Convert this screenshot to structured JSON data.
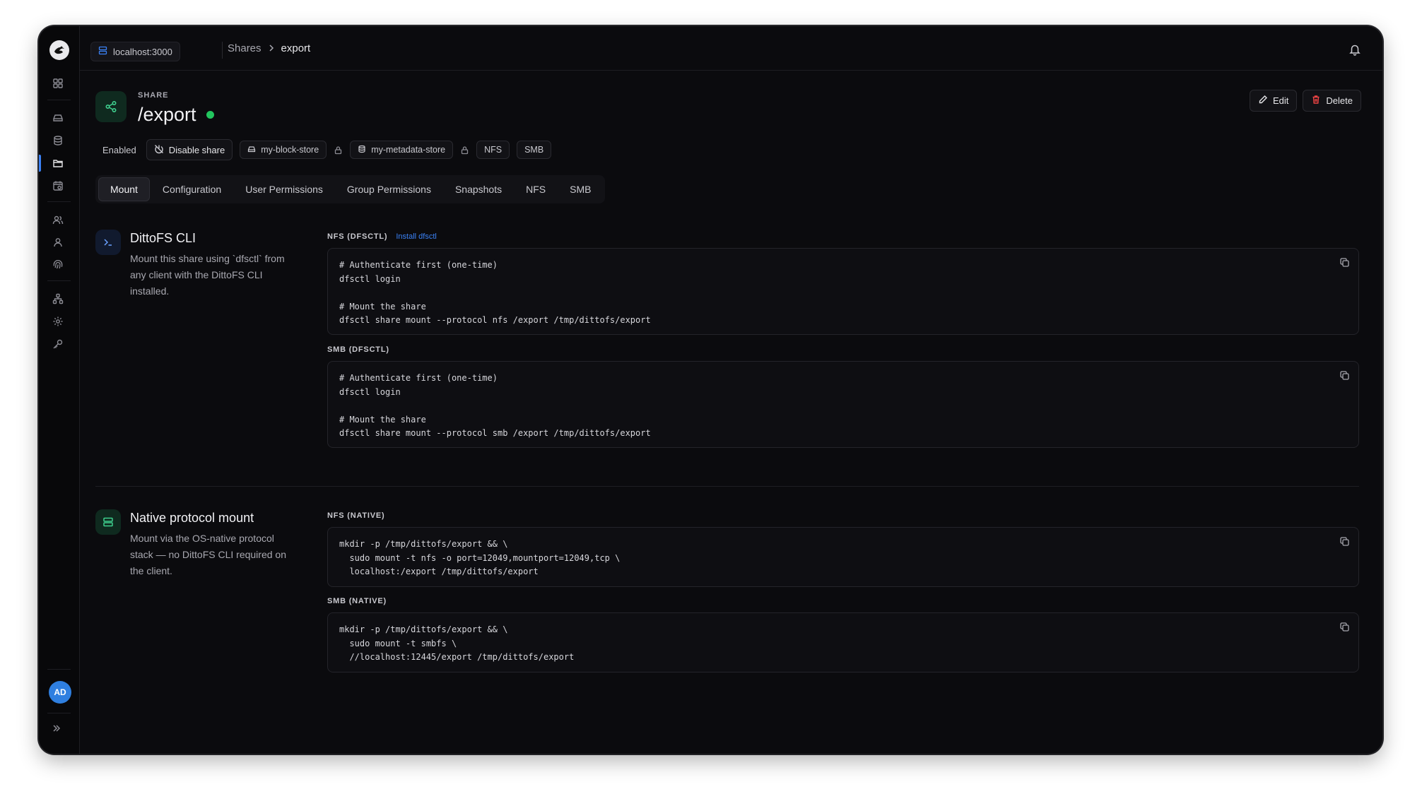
{
  "topbar": {
    "server": "localhost:3000",
    "breadcrumb": [
      "Shares",
      "export"
    ]
  },
  "share": {
    "kicker": "SHARE",
    "title": "/export",
    "status": "Enabled",
    "disable_label": "Disable share",
    "block_store": "my-block-store",
    "metadata_store": "my-metadata-store",
    "protocols": [
      "NFS",
      "SMB"
    ]
  },
  "actions": {
    "edit": "Edit",
    "delete": "Delete"
  },
  "tabs": [
    "Mount",
    "Configuration",
    "User Permissions",
    "Group Permissions",
    "Snapshots",
    "NFS",
    "SMB"
  ],
  "sections": {
    "cli": {
      "title": "DittoFS CLI",
      "description": "Mount this share using `dfsctl` from any client with the DittoFS CLI installed.",
      "nfs_label": "NFS (DFSCTL)",
      "install_link": "Install dfsctl",
      "nfs_code": [
        "# Authenticate first (one-time)",
        "dfsctl login",
        "",
        "# Mount the share",
        "dfsctl share mount --protocol nfs /export /tmp/dittofs/export"
      ],
      "smb_label": "SMB (DFSCTL)",
      "smb_code": [
        "# Authenticate first (one-time)",
        "dfsctl login",
        "",
        "# Mount the share",
        "dfsctl share mount --protocol smb /export /tmp/dittofs/export"
      ]
    },
    "native": {
      "title": "Native protocol mount",
      "description": "Mount via the OS-native protocol stack — no DittoFS CLI required on the client.",
      "nfs_label": "NFS (NATIVE)",
      "nfs_code": [
        "mkdir -p /tmp/dittofs/export && \\",
        "  sudo mount -t nfs -o port=12049,mountport=12049,tcp \\",
        "  localhost:/export /tmp/dittofs/export"
      ],
      "smb_label": "SMB (NATIVE)",
      "smb_code": [
        "mkdir -p /tmp/dittofs/export && \\",
        "  sudo mount -t smbfs \\",
        "  //localhost:12445/export /tmp/dittofs/export"
      ]
    }
  },
  "user": {
    "initials": "AD"
  },
  "colors": {
    "accent": "#3b82f6",
    "success": "#22c55e",
    "danger": "#ef4444",
    "brand_green": "#3fcf8e"
  }
}
